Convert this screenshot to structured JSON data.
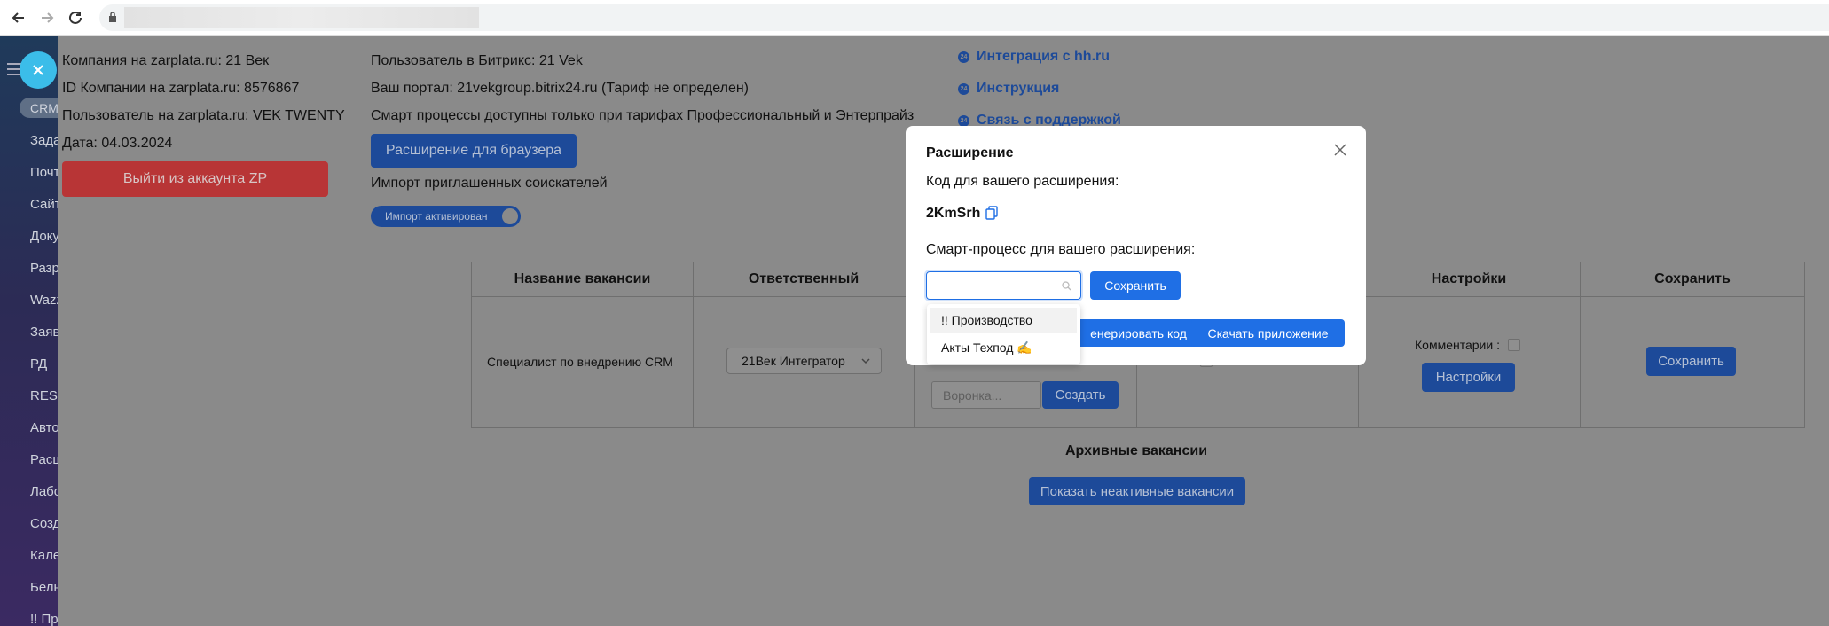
{
  "app": {
    "company": "Компания на zarplata.ru: 21 Век",
    "company_id": "ID Компании на zarplata.ru: 8576867",
    "zp_user": "Пользователь на zarplata.ru: VEK TWENTY",
    "date": "Дата: 04.03.2024",
    "logout_label": "Выйти из аккаунта ZP",
    "bitrix_user": "Пользователь в Битрикс: 21 Vek",
    "portal": "Ваш портал: 21vekgroup.bitrix24.ru (Тариф не определен)",
    "smart_notice": "Смарт процессы доступны только при тарифах Профессиональный и Энтерпрайз",
    "extension_label": "Расширение для браузера",
    "import_label": "Импорт приглашенных соискателей",
    "toggle_label": "Импорт активирован",
    "links": [
      "Интеграция с hh.ru",
      "Инструкция",
      "Связь с поддержкой"
    ],
    "link_icon": "24"
  },
  "sidebar": {
    "items": [
      "CRM",
      "Задачи",
      "Почта",
      "Сайты",
      "Документы",
      "Разработчикам",
      "Wazzup",
      "Заявки",
      "РД",
      "REST",
      "Автоматизация",
      "Расширения",
      "Лаборатория",
      "Создать",
      "Календарь",
      "Белый",
      "!! Производство"
    ]
  },
  "table": {
    "headers": [
      "Название вакансии",
      "Ответственный",
      "Настройки",
      "Сохранить"
    ],
    "row": {
      "vacancy": "Специалист по внедрению CRM",
      "responsible": "21Век Интегратор",
      "funnel_placeholder": "Воронка...",
      "create_label": "Создать",
      "comments_label": "Комментарии :",
      "settings_label": "Настройки",
      "save_label": "Сохранить"
    }
  },
  "archive": {
    "title": "Архивные вакансии",
    "show_inactive": "Показать неактивные вакансии"
  },
  "modal": {
    "title": "Расширение",
    "code_label": "Код для вашего расширения:",
    "code": "2KmSrh",
    "smart_label": "Смарт-процесс для вашего расширения:",
    "save_label": "Сохранить",
    "generate_label": "Сгенерировать код",
    "generate_visible": "енерировать код",
    "download_label": "Скачать приложение",
    "options": [
      "!! Производство",
      "Акты Техпод ✍️"
    ]
  },
  "colors": {
    "primary": "#1f6fe5",
    "danger": "#d9534f",
    "close_button": "#3bbde9"
  }
}
